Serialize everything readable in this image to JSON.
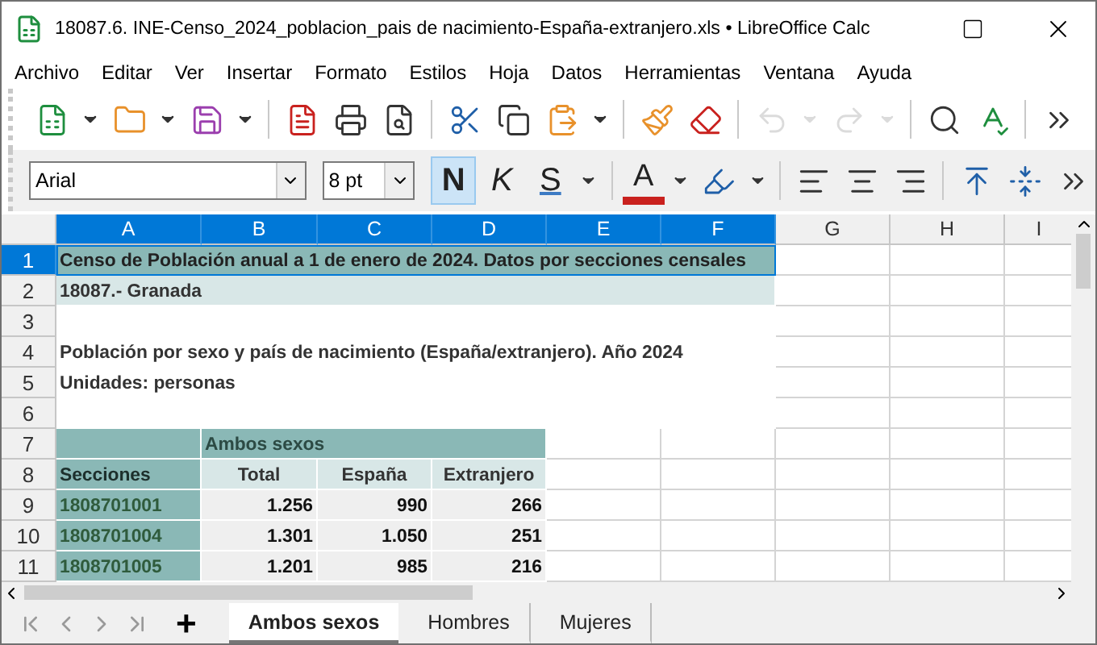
{
  "window": {
    "title": "18087.6. INE-Censo_2024_poblacion_pais de nacimiento-España-extranjero.xls • LibreOffice Calc"
  },
  "menu": [
    "Archivo",
    "Editar",
    "Ver",
    "Insertar",
    "Formato",
    "Estilos",
    "Hoja",
    "Datos",
    "Herramientas",
    "Ventana",
    "Ayuda"
  ],
  "standard_toolbar": [
    {
      "kind": "new-spreadsheet",
      "disabled": false
    },
    {
      "kind": "caret",
      "disabled": false
    },
    {
      "kind": "open",
      "disabled": false
    },
    {
      "kind": "caret",
      "disabled": false
    },
    {
      "kind": "save",
      "disabled": false
    },
    {
      "kind": "caret",
      "disabled": false
    },
    {
      "kind": "separator"
    },
    {
      "kind": "export-pdf",
      "disabled": false
    },
    {
      "kind": "print",
      "disabled": false
    },
    {
      "kind": "print-preview",
      "disabled": false
    },
    {
      "kind": "separator"
    },
    {
      "kind": "cut",
      "disabled": false
    },
    {
      "kind": "copy",
      "disabled": false
    },
    {
      "kind": "paste",
      "disabled": false
    },
    {
      "kind": "caret",
      "disabled": false
    },
    {
      "kind": "separator"
    },
    {
      "kind": "clone-formatting",
      "disabled": false
    },
    {
      "kind": "clear-formatting",
      "disabled": false
    },
    {
      "kind": "separator"
    },
    {
      "kind": "undo",
      "disabled": true
    },
    {
      "kind": "caret",
      "disabled": true
    },
    {
      "kind": "redo",
      "disabled": true
    },
    {
      "kind": "caret",
      "disabled": true
    },
    {
      "kind": "separator"
    },
    {
      "kind": "find-replace",
      "disabled": false
    },
    {
      "kind": "spelling",
      "disabled": false
    },
    {
      "kind": "separator"
    },
    {
      "kind": "overflow",
      "disabled": false
    }
  ],
  "format_toolbar": {
    "font_name": {
      "value": "Arial"
    },
    "font_size": {
      "value": "8 pt"
    },
    "style_buttons": [
      {
        "label": "N",
        "kind": "bold",
        "selected": true
      },
      {
        "label": "K",
        "kind": "italic",
        "selected": false
      },
      {
        "label": "S",
        "kind": "underline",
        "selected": false
      }
    ],
    "font_color": {
      "label": "A"
    },
    "items": [
      {
        "kind": "highlight"
      },
      {
        "kind": "caret"
      },
      {
        "kind": "separator"
      },
      {
        "kind": "align-left"
      },
      {
        "kind": "align-center"
      },
      {
        "kind": "align-right"
      },
      {
        "kind": "separator"
      },
      {
        "kind": "align-top"
      },
      {
        "kind": "align-middle"
      },
      {
        "kind": "overflow"
      }
    ]
  },
  "sheet": {
    "columns": [
      {
        "label": "A",
        "selected": true
      },
      {
        "label": "B",
        "selected": true
      },
      {
        "label": "C",
        "selected": true
      },
      {
        "label": "D",
        "selected": true
      },
      {
        "label": "E",
        "selected": true
      },
      {
        "label": "F",
        "selected": true
      },
      {
        "label": "G",
        "selected": false
      },
      {
        "label": "H",
        "selected": false
      },
      {
        "label": "I",
        "selected": false
      }
    ],
    "rows": [
      {
        "number": "1",
        "selected": true,
        "cells": [
          {
            "kind": "title",
            "text": "Censo de Población anual a 1 de enero de 2024. Datos por secciones censales"
          }
        ]
      },
      {
        "number": "2",
        "selected": false,
        "cells": [
          {
            "kind": "subtitle",
            "text": "18087.- Granada"
          }
        ]
      },
      {
        "number": "3",
        "selected": false
      },
      {
        "number": "4",
        "selected": false,
        "cells": [
          {
            "kind": "note",
            "text": "Población por sexo y  país de nacimiento (España/extranjero). Año 2024"
          }
        ]
      },
      {
        "number": "5",
        "selected": false,
        "cells": [
          {
            "kind": "note",
            "text": "Unidades: personas"
          }
        ]
      },
      {
        "number": "6",
        "selected": false
      },
      {
        "number": "7",
        "selected": false,
        "cells": [
          {
            "kind": "corner"
          },
          {
            "kind": "group",
            "text": "Ambos sexos"
          }
        ]
      },
      {
        "number": "8",
        "selected": false,
        "cells": [
          {
            "kind": "head-code",
            "text": "Secciones"
          },
          {
            "kind": "head",
            "text": "Total"
          },
          {
            "kind": "head",
            "text": "España"
          },
          {
            "kind": "head",
            "text": "Extranjero"
          }
        ]
      },
      {
        "number": "9",
        "selected": false,
        "cells": [
          {
            "kind": "code",
            "text": "1808701001"
          },
          {
            "kind": "number",
            "text": "1.256"
          },
          {
            "kind": "number",
            "text": "990"
          },
          {
            "kind": "number",
            "text": "266"
          }
        ]
      },
      {
        "number": "10",
        "selected": false,
        "cells": [
          {
            "kind": "code",
            "text": "1808701004"
          },
          {
            "kind": "number",
            "text": "1.301"
          },
          {
            "kind": "number",
            "text": "1.050"
          },
          {
            "kind": "number",
            "text": "251"
          }
        ]
      },
      {
        "number": "11",
        "selected": false,
        "cells": [
          {
            "kind": "code",
            "text": "1808701005"
          },
          {
            "kind": "number",
            "text": "1.201"
          },
          {
            "kind": "number",
            "text": "985"
          },
          {
            "kind": "number",
            "text": "216"
          }
        ]
      }
    ]
  },
  "sheet_tabs": {
    "add": {
      "label": "+"
    },
    "tabs": [
      {
        "label": "Ambos sexos",
        "selected": true
      },
      {
        "label": "Hombres",
        "selected": false
      },
      {
        "label": "Mujeres",
        "selected": false
      }
    ]
  }
}
